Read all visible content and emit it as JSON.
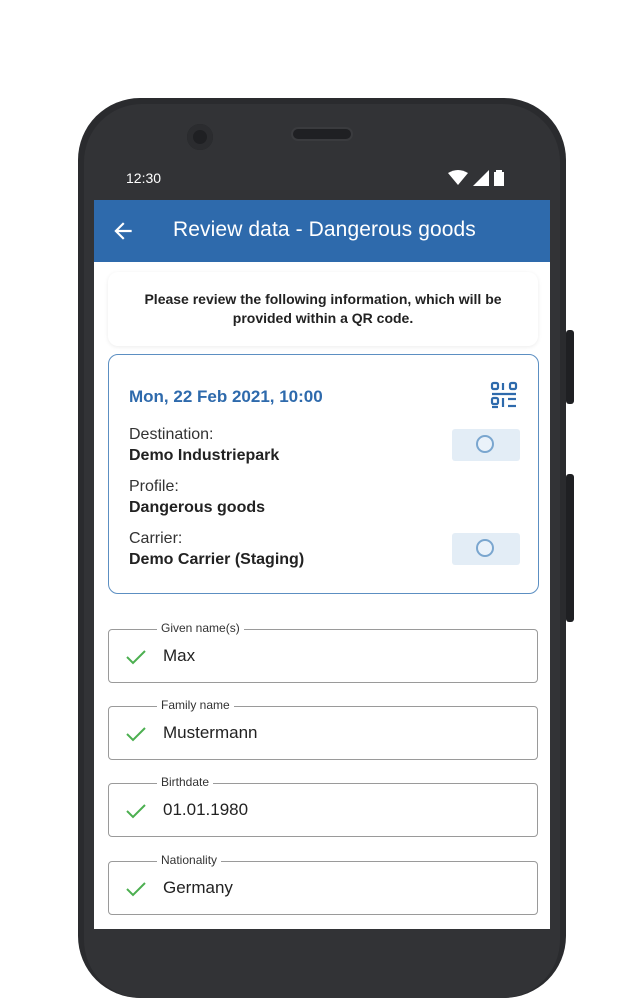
{
  "status_bar": {
    "time": "12:30",
    "icons": [
      "wifi-icon",
      "signal-icon",
      "battery-icon"
    ]
  },
  "app_bar": {
    "back_icon": "arrow-left-icon",
    "title": "Review data - Dangerous goods"
  },
  "info": {
    "text": "Please review the following information, which will be provided within a QR code."
  },
  "booking": {
    "date": "Mon, 22 Feb 2021, 10:00",
    "qr_icon": "qr-code-icon",
    "destination_label": "Destination:",
    "destination_value": "Demo Industriepark",
    "profile_label": "Profile:",
    "profile_value": "Dangerous goods",
    "carrier_label": "Carrier:",
    "carrier_value": "Demo Carrier (Staging)"
  },
  "fields": [
    {
      "label": "Given name(s)",
      "value": "Max"
    },
    {
      "label": "Family name",
      "value": "Mustermann"
    },
    {
      "label": "Birthdate",
      "value": "01.01.1980"
    },
    {
      "label": "Nationality",
      "value": "Germany"
    }
  ],
  "colors": {
    "accent": "#2e6aac",
    "check": "#4caf50",
    "card_border": "#5c8fc2"
  }
}
